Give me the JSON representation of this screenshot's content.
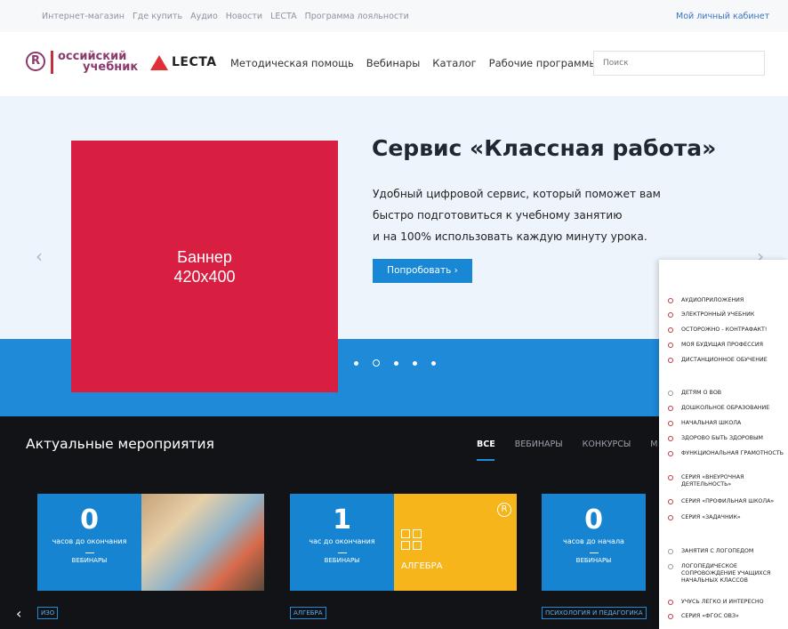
{
  "topbar": {
    "links": [
      "Интернет-магазин",
      "Где купить",
      "Аудио",
      "Новости",
      "LECTA",
      "Программа лояльности"
    ],
    "cabinet": "Мой личный кабинет"
  },
  "header": {
    "logo_r": "R",
    "logo_line1": "оссийский",
    "logo_line2": "учебник",
    "lecta": "LECTA",
    "nav": [
      "Методическая помощь",
      "Вебинары",
      "Каталог",
      "Рабочие программы"
    ],
    "search_placeholder": "Поиск"
  },
  "hero": {
    "banner_line1": "Баннер",
    "banner_line2": "420х400",
    "title": "Сервис «Классная работа»",
    "text_line1": "Удобный цифровой сервис, который поможет вам",
    "text_line2": "быстро подготовиться к учебному занятию",
    "text_line3": "и на 100% использовать каждую минуту урока.",
    "button": "Попробовать  ›",
    "arrow_left": "‹",
    "arrow_right": "›"
  },
  "events": {
    "title": "Актуальные мероприятия",
    "filters": [
      "ВСЕ",
      "ВЕБИНАРЫ",
      "КОНКУРСЫ",
      "М"
    ],
    "cards": [
      {
        "number": "0",
        "label": "часов до окончания",
        "type": "ВЕБИНАРЫ",
        "tag": "ИЗО"
      },
      {
        "number": "1",
        "label": "час до окончания",
        "type": "ВЕБИНАРЫ",
        "tag": "АЛГЕБРА",
        "image_text": "АЛГЕБРА"
      },
      {
        "number": "0",
        "label": "часов до начала",
        "type": "ВЕБИНАРЫ",
        "tag": "ПСИХОЛОГИЯ И ПЕДАГОГИКА"
      }
    ],
    "left_arrow": "‹"
  },
  "side_list": {
    "group1": [
      "Аудиоприложения",
      "Электронный учебник",
      "Осторожно - контрафакт!",
      "Моя будущая профессия",
      "Дистанционное обучение"
    ],
    "group2": [
      "Детям о ВОВ",
      "Дошкольное образование",
      "Начальная школа",
      "Здорово быть здоровым",
      "Функциональная грамотность",
      "Серия «Внеурочная деятельность»",
      "Серия «Профильная школа»",
      "Серия «Задачник»"
    ],
    "group3": [
      "Занятия с логопедом",
      "Логопедическое сопровождение учащихся начальных классов",
      "Учусь легко и интересно",
      "Серия «ФГОС ОВЗ»"
    ]
  }
}
